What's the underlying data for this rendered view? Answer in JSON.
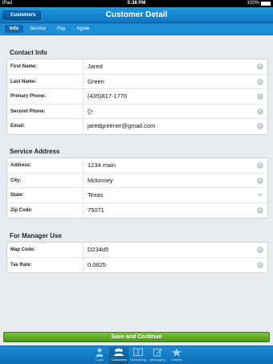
{
  "status_bar": {
    "device": "iPad",
    "time": "5:38 PM",
    "battery": "100%"
  },
  "nav": {
    "back_label": "Customers",
    "title": "Customer Detail"
  },
  "tabs": [
    {
      "label": "Info",
      "active": true
    },
    {
      "label": "Service",
      "active": false
    },
    {
      "label": "Pay",
      "active": false
    },
    {
      "label": "Agree",
      "active": false
    }
  ],
  "contact": {
    "title": "Contact Info",
    "fields": [
      {
        "label": "First Name:",
        "value": "Jared"
      },
      {
        "label": "Last Name:",
        "value": "Green"
      },
      {
        "label": "Primary Phone:",
        "value": "(435)817-1770"
      },
      {
        "label": "Second Phone:",
        "value": "()-"
      },
      {
        "label": "Email:",
        "value": "jaredgreener@gmail.com"
      }
    ]
  },
  "service": {
    "title": "Service Address",
    "fields": [
      {
        "label": "Address:",
        "value": "1234 main"
      },
      {
        "label": "City:",
        "value": "Mckinney"
      },
      {
        "label": "State:",
        "value": "Texas"
      },
      {
        "label": "Zip Code:",
        "value": "75071"
      }
    ]
  },
  "manager": {
    "title": "For Manager Use",
    "fields": [
      {
        "label": "Map Code:",
        "value": "D234d5"
      },
      {
        "label": "Tax Rate:",
        "value": "0.0825"
      }
    ]
  },
  "save_label": "Save and Continue",
  "bottom_tabs": [
    {
      "label": "Login",
      "icon": "person-icon",
      "active": false
    },
    {
      "label": "Customers",
      "icon": "group-icon",
      "active": true
    },
    {
      "label": "Scheduling",
      "icon": "book-icon",
      "active": false
    },
    {
      "label": "Messaging",
      "icon": "compose-icon",
      "active": false
    },
    {
      "label": "Leaders",
      "icon": "star-icon",
      "active": false
    }
  ],
  "colors": {
    "accent": "#1d98e0",
    "save": "#5fa826"
  }
}
